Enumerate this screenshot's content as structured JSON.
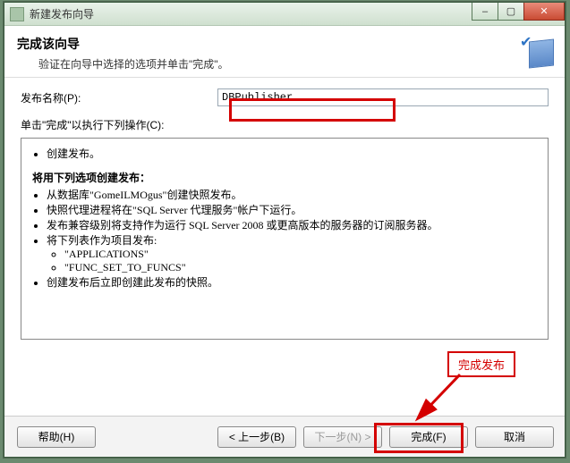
{
  "window": {
    "title": "新建发布向导"
  },
  "header": {
    "title": "完成该向导",
    "subtitle": "验证在向导中选择的选项并单击\"完成\"。"
  },
  "form": {
    "name_label": "发布名称(P):",
    "name_value": "DBPublisher",
    "operations_label": "单击\"完成\"以执行下列操作(C):"
  },
  "summary": {
    "line1": "创建发布。",
    "section_title": "将用下列选项创建发布：",
    "opt1": "从数据库\"GomeILMOgus\"创建快照发布。",
    "opt2": "快照代理进程将在\"SQL Server 代理服务\"帐户下运行。",
    "opt3": "发布兼容级别将支持作为运行 SQL Server 2008 或更高版本的服务器的订阅服务器。",
    "opt4_head": "将下列表作为项目发布:",
    "opt4a": "\"APPLICATIONS\"",
    "opt4b": "\"FUNC_SET_TO_FUNCS\"",
    "opt5": "创建发布后立即创建此发布的快照。"
  },
  "buttons": {
    "help": "帮助(H)",
    "back": "< 上一步(B)",
    "next": "下一步(N) >",
    "finish": "完成(F)",
    "cancel": "取消"
  },
  "annotation": {
    "label": "完成发布"
  }
}
